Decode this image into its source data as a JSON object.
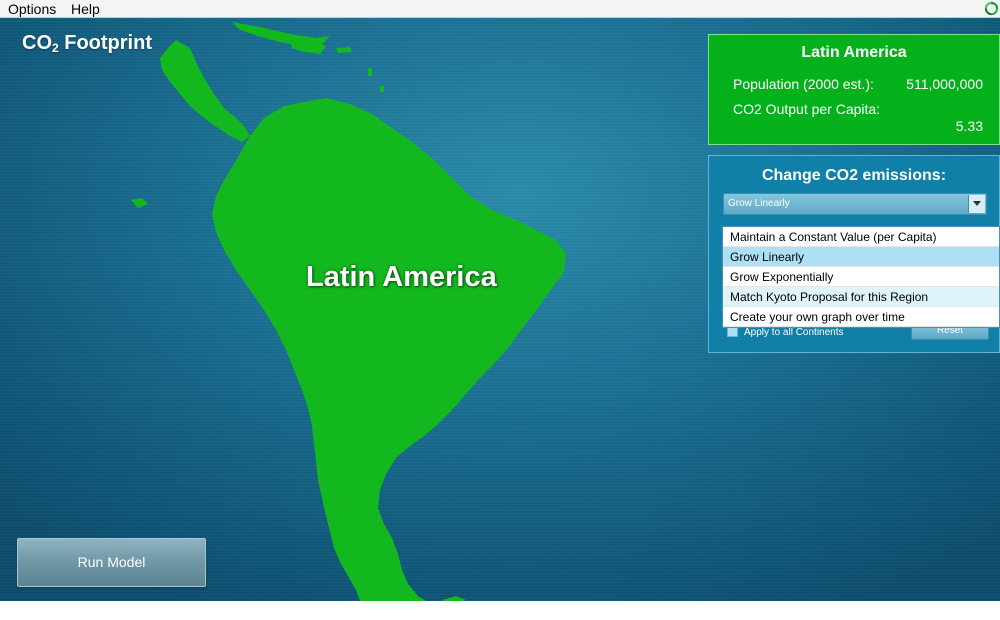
{
  "menu": {
    "items": [
      "Options",
      "Help"
    ]
  },
  "app": {
    "title_main": "CO",
    "title_sub": "2",
    "title_rest": " Footprint"
  },
  "map": {
    "region_label": "Latin America",
    "land_color": "#13b81f",
    "ocean_color": "#1a6e91"
  },
  "info_panel": {
    "title": "Latin America",
    "population_label": "Population (2000 est.):",
    "population_value": "511,000,000",
    "co2_label": "CO2 Output per Capita:",
    "co2_value": "5.33",
    "bg_color": "#05b11a"
  },
  "emissions_panel": {
    "title": "Change CO2 emissions:",
    "selected": "Grow Linearly",
    "options": [
      "Maintain a Constant Value (per Capita)",
      "Grow Linearly",
      "Grow Exponentially",
      "Match Kyoto Proposal for this Region",
      "Create your own graph over time"
    ],
    "apply_all_label": "Apply to all Continents",
    "reset_label": "Reset",
    "bg_color": "#1180a9"
  },
  "run_button": {
    "label": "Run Model"
  },
  "icons": {
    "refresh": "refresh-icon",
    "dropdown": "chevron-down-icon"
  }
}
